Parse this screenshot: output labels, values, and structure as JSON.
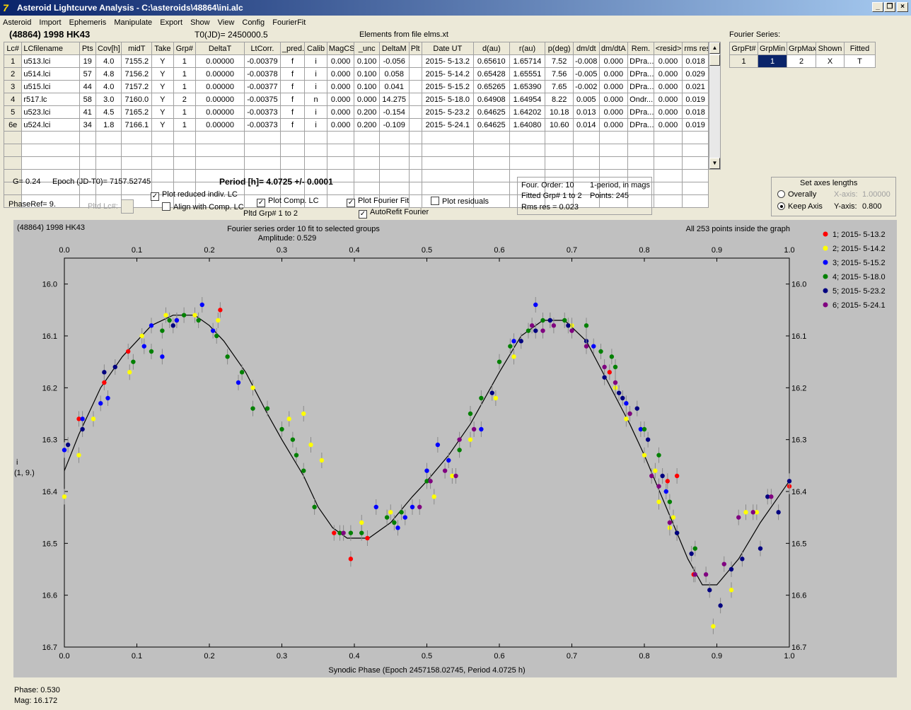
{
  "window": {
    "title": "Asteroid Lightcurve Analysis - C:\\asteroids\\48864\\ini.alc",
    "app_icon": "7",
    "btn_minimize": "_",
    "btn_restore": "❐",
    "btn_close": "×"
  },
  "menu": [
    "Asteroid",
    "Import",
    "Ephemeris",
    "Manipulate",
    "Export",
    "Show",
    "View",
    "Config",
    "FourierFit"
  ],
  "header": {
    "asteroid": "(48864) 1998 HK43",
    "t0": "T0(JD)= 2450000.5",
    "elements": "Elements from file elms.xt",
    "fourier_label": "Fourier Series:"
  },
  "lc_table": {
    "columns": [
      "Lc#",
      "LCfilename",
      "Pts",
      "Cov[h]",
      "midT",
      "Take",
      "Grp#",
      "DeltaT",
      "LtCorr.",
      "_pred.",
      "Calib",
      "MagCS",
      "_unc",
      "DeltaM",
      "Plt",
      "Date UT",
      "d(au)",
      "r(au)",
      "p(deg)",
      "dm/dt",
      "dm/dtA",
      "Rem.",
      "<resid>",
      "rms res"
    ],
    "rows": [
      [
        "1",
        "u513.lci",
        "19",
        "4.0",
        "7155.2",
        "Y",
        "1",
        "0.00000",
        "-0.00379",
        "f",
        "i",
        "0.000",
        "0.100",
        "-0.056",
        "",
        "2015- 5-13.2",
        "0.65610",
        "1.65714",
        "7.52",
        "-0.008",
        "0.000",
        "DPra...",
        "0.000",
        "0.018"
      ],
      [
        "2",
        "u514.lci",
        "57",
        "4.8",
        "7156.2",
        "Y",
        "1",
        "0.00000",
        "-0.00378",
        "f",
        "i",
        "0.000",
        "0.100",
        "0.058",
        "",
        "2015- 5-14.2",
        "0.65428",
        "1.65551",
        "7.56",
        "-0.005",
        "0.000",
        "DPra...",
        "0.000",
        "0.029"
      ],
      [
        "3",
        "u515.lci",
        "44",
        "4.0",
        "7157.2",
        "Y",
        "1",
        "0.00000",
        "-0.00377",
        "f",
        "i",
        "0.000",
        "0.100",
        "0.041",
        "",
        "2015- 5-15.2",
        "0.65265",
        "1.65390",
        "7.65",
        "-0.002",
        "0.000",
        "DPra...",
        "0.000",
        "0.021"
      ],
      [
        "4",
        "r517.lc",
        "58",
        "3.0",
        "7160.0",
        "Y",
        "2",
        "0.00000",
        "-0.00375",
        "f",
        "n",
        "0.000",
        "0.000",
        "14.275",
        "",
        "2015- 5-18.0",
        "0.64908",
        "1.64954",
        "8.22",
        "0.005",
        "0.000",
        "Ondr...",
        "0.000",
        "0.019"
      ],
      [
        "5",
        "u523.lci",
        "41",
        "4.5",
        "7165.2",
        "Y",
        "1",
        "0.00000",
        "-0.00373",
        "f",
        "i",
        "0.000",
        "0.200",
        "-0.154",
        "",
        "2015- 5-23.2",
        "0.64625",
        "1.64202",
        "10.18",
        "0.013",
        "0.000",
        "DPra...",
        "0.000",
        "0.018"
      ],
      [
        "6e",
        "u524.lci",
        "34",
        "1.8",
        "7166.1",
        "Y",
        "1",
        "0.00000",
        "-0.00373",
        "f",
        "i",
        "0.000",
        "0.200",
        "-0.109",
        "",
        "2015- 5-24.1",
        "0.64625",
        "1.64080",
        "10.60",
        "0.014",
        "0.000",
        "DPra...",
        "0.000",
        "0.019"
      ]
    ],
    "scroll_up": "▲",
    "scroll_down": "▼"
  },
  "fourier_table": {
    "columns": [
      "GrpFt#",
      "GrpMin",
      "GrpMax",
      "Shown",
      "Fitted"
    ],
    "rows": [
      [
        "1",
        "1",
        "2",
        "X",
        "T"
      ]
    ]
  },
  "controls": {
    "g": "G= 0.24",
    "epoch": "Epoch (JD-T0)= 7157.52745",
    "period": "Period [h]= 4.0725 +/- 0.0001",
    "phaseref": "PhaseRef= 9.",
    "pltd_lc": "Pltd Lc#:",
    "plot_reduced": "Plot reduced indiv. LC",
    "align": "Align with Comp. LC",
    "plot_comp": "Plot Comp. LC",
    "pltd_grp": "Pltd Grp#  1   to   2",
    "plot_fourier": "Plot Fourier Fit",
    "autorefit": "AutoRefit Fourier",
    "plot_resid": "Plot residuals",
    "check_mark": "✓",
    "fit_order": "Four. Order: 10",
    "fit_period": "1-period, in mags",
    "fit_grp": "Fitted Grp# 1 to 2",
    "fit_points": "Points: 245",
    "fit_rms": "Rms res    = 0.023",
    "axes_title": "Set axes lengths",
    "overally": "Overally",
    "keep_axis": "Keep Axis",
    "xaxis_label": "X-axis:",
    "xaxis_val": "1.00000",
    "yaxis_label": "Y-axis:",
    "yaxis_val": "0.800"
  },
  "status": {
    "phase": "Phase:  0.530",
    "mag": "Mag:    16.172"
  },
  "chart_data": {
    "type": "scatter",
    "title": "Fourier series order 10 fit to selected groups",
    "subtitle": "Amplitude: 0.529",
    "top_left_label": "(48864) 1998 HK43",
    "top_right_label": "All 253 points inside the graph",
    "xlabel": "Synodic Phase (Epoch 2457158.02745, Period 4.0725 h)",
    "ylabel": [
      "i",
      "(1, 9.)"
    ],
    "xlim": [
      0.0,
      1.0
    ],
    "ylim": [
      16.7,
      15.95
    ],
    "x_ticks": [
      0.0,
      0.1,
      0.2,
      0.3,
      0.4,
      0.5,
      0.6,
      0.7,
      0.8,
      0.9,
      1.0
    ],
    "x_tick_labels": [
      "0.0",
      "0.1",
      "0.2",
      "0.3",
      "0.4",
      "0.5",
      "0.6",
      "0.7",
      "0.8",
      "0.9",
      "1.0"
    ],
    "y_ticks": [
      16.0,
      16.1,
      16.2,
      16.3,
      16.4,
      16.5,
      16.6,
      16.7
    ],
    "y_tick_labels": [
      "16.0",
      "16.1",
      "16.2",
      "16.3",
      "16.4",
      "16.5",
      "16.6",
      "16.7"
    ],
    "fit_curve": {
      "x": [
        0.0,
        0.02,
        0.05,
        0.08,
        0.1,
        0.12,
        0.15,
        0.18,
        0.2,
        0.22,
        0.25,
        0.28,
        0.3,
        0.33,
        0.35,
        0.37,
        0.39,
        0.42,
        0.45,
        0.48,
        0.5,
        0.53,
        0.56,
        0.6,
        0.63,
        0.66,
        0.69,
        0.72,
        0.75,
        0.78,
        0.8,
        0.83,
        0.86,
        0.88,
        0.9,
        0.93,
        0.96,
        1.0
      ],
      "y": [
        16.36,
        16.29,
        16.2,
        16.14,
        16.11,
        16.08,
        16.06,
        16.06,
        16.08,
        16.11,
        16.17,
        16.25,
        16.3,
        16.37,
        16.43,
        16.47,
        16.49,
        16.49,
        16.46,
        16.41,
        16.38,
        16.33,
        16.27,
        16.17,
        16.1,
        16.07,
        16.07,
        16.11,
        16.19,
        16.27,
        16.33,
        16.43,
        16.53,
        16.58,
        16.58,
        16.53,
        16.46,
        16.38
      ]
    },
    "series": [
      {
        "name": "1; 2015- 5-13.2",
        "color": "#ff0000",
        "points": [
          [
            0.02,
            16.26
          ],
          [
            0.055,
            16.19
          ],
          [
            0.088,
            16.13
          ],
          [
            0.155,
            16.07
          ],
          [
            0.215,
            16.05
          ],
          [
            0.372,
            16.48
          ],
          [
            0.395,
            16.53
          ],
          [
            0.418,
            16.49
          ],
          [
            0.752,
            16.17
          ],
          [
            0.832,
            16.38
          ],
          [
            0.845,
            16.37
          ],
          [
            0.868,
            16.56
          ],
          [
            1.0,
            16.39
          ]
        ]
      },
      {
        "name": "2; 2015- 5-14.2",
        "color": "#ffff00",
        "points": [
          [
            0.0,
            16.41
          ],
          [
            0.02,
            16.33
          ],
          [
            0.04,
            16.26
          ],
          [
            0.09,
            16.17
          ],
          [
            0.107,
            16.1
          ],
          [
            0.14,
            16.06
          ],
          [
            0.18,
            16.06
          ],
          [
            0.212,
            16.07
          ],
          [
            0.26,
            16.2
          ],
          [
            0.31,
            16.26
          ],
          [
            0.33,
            16.25
          ],
          [
            0.34,
            16.31
          ],
          [
            0.355,
            16.34
          ],
          [
            0.41,
            16.46
          ],
          [
            0.45,
            16.44
          ],
          [
            0.51,
            16.41
          ],
          [
            0.535,
            16.37
          ],
          [
            0.56,
            16.3
          ],
          [
            0.595,
            16.22
          ],
          [
            0.62,
            16.14
          ],
          [
            0.7,
            16.08
          ],
          [
            0.76,
            16.2
          ],
          [
            0.775,
            16.26
          ],
          [
            0.8,
            16.33
          ],
          [
            0.815,
            16.36
          ],
          [
            0.82,
            16.42
          ],
          [
            0.84,
            16.45
          ],
          [
            0.835,
            16.47
          ],
          [
            0.895,
            16.66
          ],
          [
            0.92,
            16.59
          ],
          [
            0.94,
            16.44
          ],
          [
            0.955,
            16.44
          ]
        ]
      },
      {
        "name": "3; 2015- 5-15.2",
        "color": "#0000ff",
        "points": [
          [
            0.0,
            16.32
          ],
          [
            0.025,
            16.26
          ],
          [
            0.05,
            16.23
          ],
          [
            0.06,
            16.22
          ],
          [
            0.11,
            16.12
          ],
          [
            0.12,
            16.08
          ],
          [
            0.135,
            16.14
          ],
          [
            0.155,
            16.07
          ],
          [
            0.19,
            16.04
          ],
          [
            0.205,
            16.09
          ],
          [
            0.24,
            16.19
          ],
          [
            0.43,
            16.43
          ],
          [
            0.46,
            16.47
          ],
          [
            0.47,
            16.45
          ],
          [
            0.48,
            16.43
          ],
          [
            0.5,
            16.36
          ],
          [
            0.515,
            16.31
          ],
          [
            0.53,
            16.34
          ],
          [
            0.575,
            16.28
          ],
          [
            0.62,
            16.11
          ],
          [
            0.65,
            16.04
          ],
          [
            0.67,
            16.07
          ],
          [
            0.73,
            16.12
          ],
          [
            0.775,
            16.23
          ],
          [
            0.795,
            16.28
          ],
          [
            0.83,
            16.4
          ]
        ]
      },
      {
        "name": "4; 2015- 5-18.0",
        "color": "#008000",
        "points": [
          [
            0.095,
            16.15
          ],
          [
            0.12,
            16.13
          ],
          [
            0.135,
            16.09
          ],
          [
            0.145,
            16.07
          ],
          [
            0.165,
            16.06
          ],
          [
            0.185,
            16.07
          ],
          [
            0.21,
            16.1
          ],
          [
            0.225,
            16.14
          ],
          [
            0.245,
            16.17
          ],
          [
            0.26,
            16.24
          ],
          [
            0.28,
            16.24
          ],
          [
            0.3,
            16.28
          ],
          [
            0.315,
            16.3
          ],
          [
            0.32,
            16.33
          ],
          [
            0.33,
            16.36
          ],
          [
            0.345,
            16.43
          ],
          [
            0.38,
            16.48
          ],
          [
            0.395,
            16.48
          ],
          [
            0.41,
            16.48
          ],
          [
            0.445,
            16.45
          ],
          [
            0.455,
            16.46
          ],
          [
            0.465,
            16.44
          ],
          [
            0.5,
            16.38
          ],
          [
            0.545,
            16.32
          ],
          [
            0.56,
            16.25
          ],
          [
            0.575,
            16.22
          ],
          [
            0.6,
            16.15
          ],
          [
            0.615,
            16.12
          ],
          [
            0.64,
            16.09
          ],
          [
            0.66,
            16.07
          ],
          [
            0.69,
            16.07
          ],
          [
            0.72,
            16.08
          ],
          [
            0.74,
            16.13
          ],
          [
            0.755,
            16.14
          ],
          [
            0.76,
            16.16
          ],
          [
            0.78,
            16.25
          ],
          [
            0.8,
            16.28
          ],
          [
            0.82,
            16.33
          ],
          [
            0.835,
            16.42
          ],
          [
            0.845,
            16.48
          ],
          [
            0.87,
            16.51
          ]
        ]
      },
      {
        "name": "5; 2015- 5-23.2",
        "color": "#000080",
        "points": [
          [
            0.005,
            16.31
          ],
          [
            0.025,
            16.28
          ],
          [
            0.055,
            16.17
          ],
          [
            0.07,
            16.16
          ],
          [
            0.15,
            16.08
          ],
          [
            0.59,
            16.21
          ],
          [
            0.63,
            16.11
          ],
          [
            0.65,
            16.09
          ],
          [
            0.67,
            16.07
          ],
          [
            0.695,
            16.08
          ],
          [
            0.72,
            16.11
          ],
          [
            0.745,
            16.18
          ],
          [
            0.765,
            16.21
          ],
          [
            0.77,
            16.22
          ],
          [
            0.79,
            16.24
          ],
          [
            0.805,
            16.3
          ],
          [
            0.825,
            16.37
          ],
          [
            0.845,
            16.48
          ],
          [
            0.865,
            16.52
          ],
          [
            0.89,
            16.59
          ],
          [
            0.905,
            16.62
          ],
          [
            0.92,
            16.55
          ],
          [
            0.935,
            16.53
          ],
          [
            0.96,
            16.51
          ],
          [
            0.97,
            16.41
          ],
          [
            0.985,
            16.44
          ],
          [
            1.0,
            16.38
          ]
        ]
      },
      {
        "name": "6; 2015- 5-24.1",
        "color": "#800080",
        "points": [
          [
            0.385,
            16.48
          ],
          [
            0.49,
            16.43
          ],
          [
            0.505,
            16.38
          ],
          [
            0.525,
            16.36
          ],
          [
            0.54,
            16.37
          ],
          [
            0.545,
            16.3
          ],
          [
            0.565,
            16.28
          ],
          [
            0.645,
            16.08
          ],
          [
            0.66,
            16.09
          ],
          [
            0.675,
            16.08
          ],
          [
            0.7,
            16.09
          ],
          [
            0.72,
            16.12
          ],
          [
            0.745,
            16.16
          ],
          [
            0.76,
            16.19
          ],
          [
            0.78,
            16.25
          ],
          [
            0.81,
            16.37
          ],
          [
            0.82,
            16.39
          ],
          [
            0.835,
            16.46
          ],
          [
            0.87,
            16.56
          ],
          [
            0.885,
            16.56
          ],
          [
            0.91,
            16.54
          ],
          [
            0.93,
            16.45
          ],
          [
            0.95,
            16.44
          ],
          [
            0.975,
            16.41
          ]
        ]
      }
    ]
  }
}
